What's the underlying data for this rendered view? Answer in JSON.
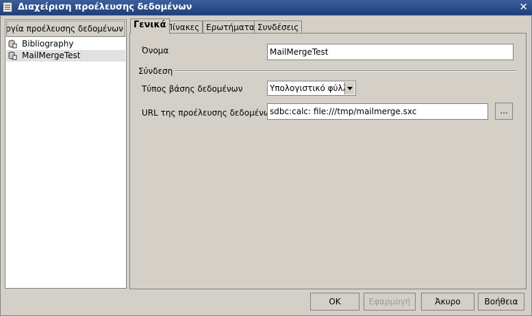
{
  "window": {
    "title": "Διαχείριση προέλευσης δεδομένων",
    "close_glyph": "✕"
  },
  "sidebar": {
    "new_button_label": "Δημιουργία προέλευσης δεδομένων",
    "items": [
      {
        "label": "Bibliography",
        "icon": "database-icon"
      },
      {
        "label": "MailMergeTest",
        "icon": "database-icon",
        "selected": true
      }
    ]
  },
  "tabs": [
    {
      "label": "Γενικά",
      "active": true
    },
    {
      "label": "Πίνακες"
    },
    {
      "label": "Ερωτήματα"
    },
    {
      "label": "Συνδέσεις"
    }
  ],
  "general": {
    "name_label": "Όνομα",
    "name_value": "MailMergeTest",
    "connection_section": "Σύνδεση",
    "db_type_label": "Τύπος βάσης δεδομένων",
    "db_type_value": "Υπολογιστικό φύλλο",
    "url_label": "URL της προέλευσης δεδομένων",
    "url_prefix": "sdbc:calc:",
    "url_value": "file:///tmp/mailmerge.sxc",
    "browse_label": "..."
  },
  "buttons": {
    "ok": "ΟΚ",
    "apply": "Εφαρμογή",
    "cancel": "Άκυρο",
    "help": "Βοήθεια"
  }
}
